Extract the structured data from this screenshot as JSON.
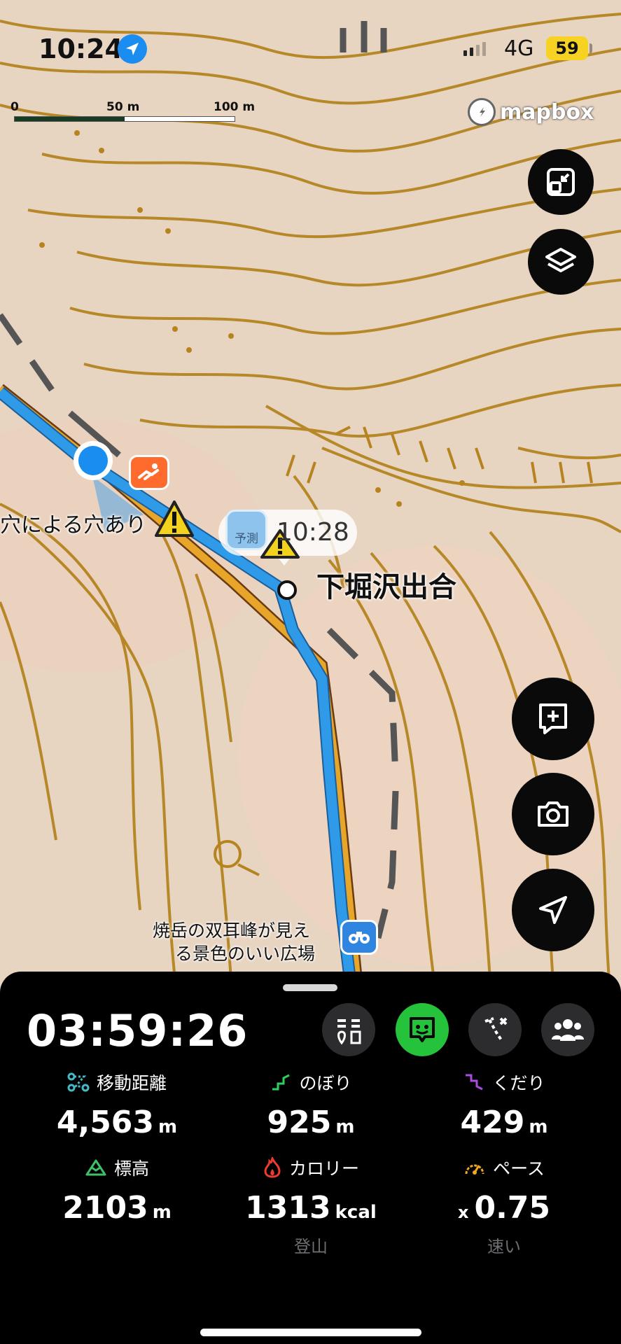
{
  "status_bar": {
    "time": "10:24",
    "network": "4G",
    "battery": "59"
  },
  "map": {
    "scale_labels": [
      "0",
      "50 m",
      "100 m"
    ],
    "attribution": "mapbox",
    "hazard_label": "穴による穴あり",
    "eta_bubble_time": "10:28",
    "eta_bubble_tag": "予測",
    "waypoint_name": "下堀沢出合",
    "poi_label_line1": "焼岳の双耳峰が見え",
    "poi_label_line2": "る景色のいい広場",
    "icons": [
      "expand-icon",
      "layers-icon",
      "add-note-icon",
      "camera-icon",
      "navigation-arrow-icon",
      "binoculars-icon",
      "warning-icon",
      "fall-hazard-icon"
    ],
    "colors": {
      "route_blue": "#2f9be8",
      "route_orange": "#e7a52a",
      "contour": "#b5841f",
      "warning": "#f2d21c"
    }
  },
  "panel": {
    "elapsed": "03:59:26",
    "stats": [
      {
        "label": "移動距離",
        "value": "4,563",
        "unit": "m",
        "icon": "distance-icon"
      },
      {
        "label": "のぼり",
        "value": "925",
        "unit": "m",
        "icon": "ascent-icon"
      },
      {
        "label": "くだり",
        "value": "429",
        "unit": "m",
        "icon": "descent-icon"
      },
      {
        "label": "標高",
        "value": "2103",
        "unit": "m",
        "icon": "elevation-icon"
      },
      {
        "label": "カロリー",
        "value": "1313",
        "unit": "kcal",
        "sub": "登山",
        "icon": "calorie-icon"
      },
      {
        "label": "ペース",
        "prefix": "x",
        "value": "0.75",
        "sub": "速い",
        "icon": "pace-icon"
      }
    ],
    "buttons": [
      "checkpoint-list-icon",
      "chat-map-icon",
      "route-icon",
      "group-icon"
    ]
  }
}
